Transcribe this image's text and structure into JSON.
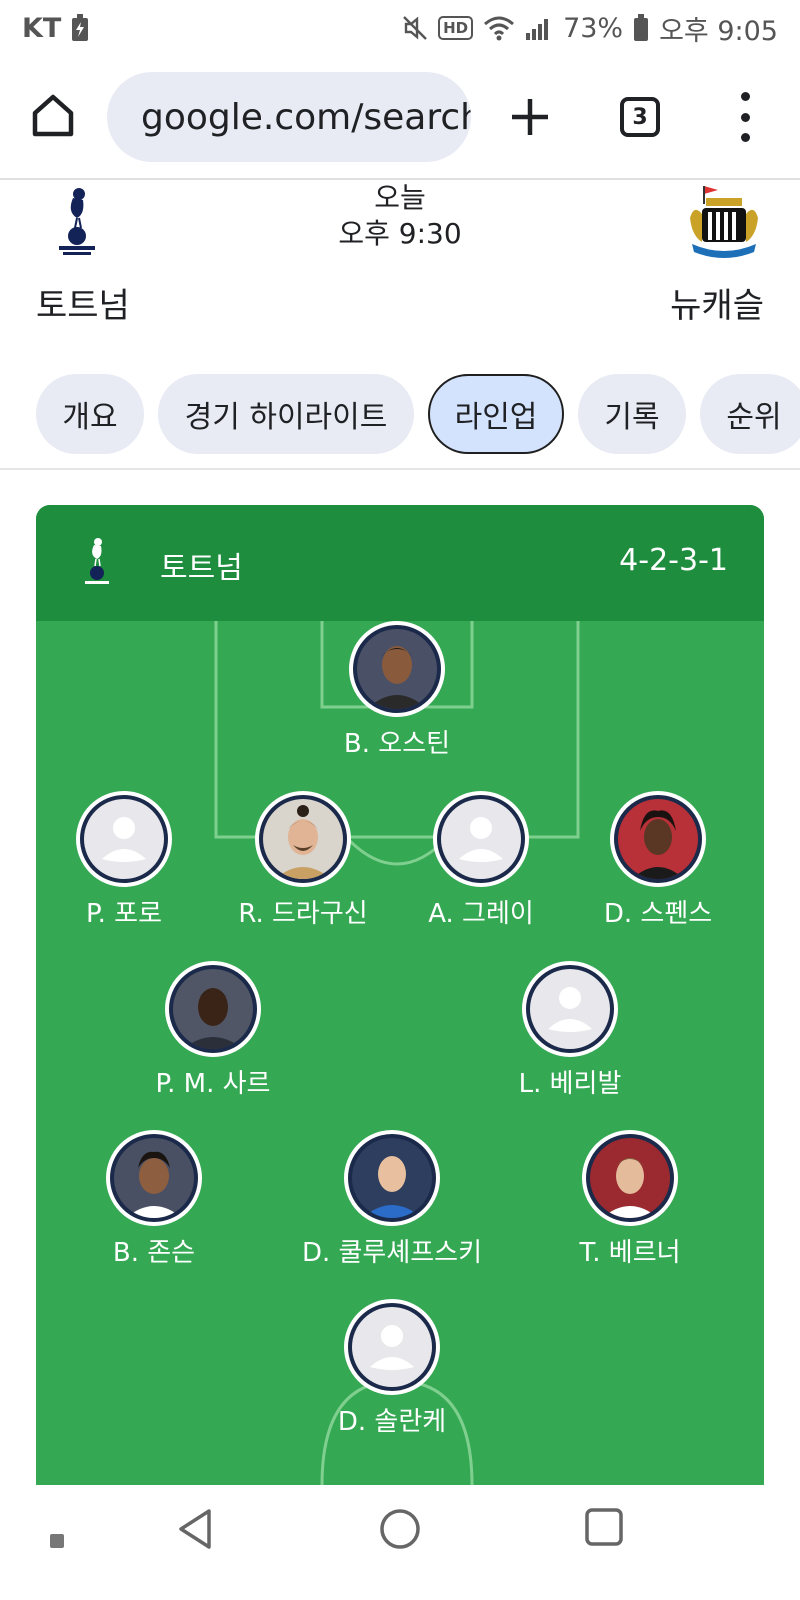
{
  "status_bar": {
    "carrier": "KT",
    "battery": "73%",
    "time": "오후 9:05",
    "network_badge": "HD"
  },
  "browser": {
    "url": "google.com/search",
    "tab_count": "3"
  },
  "match": {
    "home_team": "토트넘",
    "away_team": "뉴캐슬",
    "day": "오늘",
    "kickoff": "오후 9:30"
  },
  "tabs": [
    {
      "label": "개요"
    },
    {
      "label": "경기 하이라이트"
    },
    {
      "label": "라인업",
      "active": true
    },
    {
      "label": "기록"
    },
    {
      "label": "순위"
    }
  ],
  "lineup": {
    "team": "토트넘",
    "formation": "4-2-3-1",
    "players": [
      {
        "name": "B. 오스틴",
        "photo": "photo"
      },
      {
        "name": "P. 포로",
        "photo": "placeholder"
      },
      {
        "name": "R. 드라구신",
        "photo": "photo"
      },
      {
        "name": "A. 그레이",
        "photo": "placeholder"
      },
      {
        "name": "D. 스펜스",
        "photo": "photo"
      },
      {
        "name": "P. M. 사르",
        "photo": "photo"
      },
      {
        "name": "L. 베리발",
        "photo": "placeholder"
      },
      {
        "name": "B. 존슨",
        "photo": "photo"
      },
      {
        "name": "D. 쿨루셰프스키",
        "photo": "photo"
      },
      {
        "name": "T. 베르너",
        "photo": "photo"
      },
      {
        "name": "D. 솔란케",
        "photo": "placeholder"
      }
    ]
  },
  "colors": {
    "pitch": "#34a853",
    "pitch_header": "#1e8e3e",
    "chip": "#e8eaf4",
    "chip_active": "#d3e3fd"
  }
}
